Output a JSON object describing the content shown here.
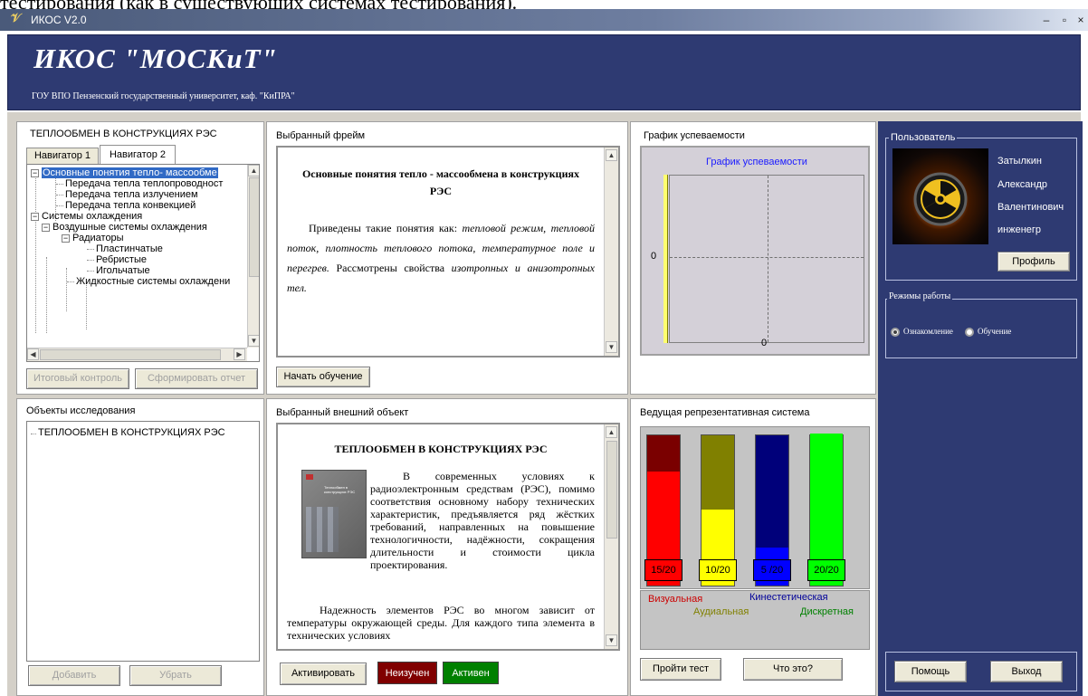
{
  "doc_caption": "тестирования (как в существующих системах тестирования).",
  "window": {
    "title": "ИКОС V2.0",
    "min": "–",
    "max": "▫",
    "close": "×"
  },
  "banner": {
    "title": "ИКОС  \"МОСКиТ\"",
    "subtitle": "ГОУ ВПО Пензенский государственный университет, каф. \"КиПРА\""
  },
  "navigator": {
    "title": "ТЕПЛООБМЕН В КОНСТРУКЦИЯХ РЭС",
    "tabs": [
      "Навигатор 1",
      "Навигатор 2"
    ],
    "active_tab": "Навигатор 2",
    "tree": [
      {
        "label": "Основные понятия тепло- массообме",
        "expander": "−",
        "selected": true
      },
      {
        "label": "Передача тепла теплопроводност"
      },
      {
        "label": "Передача тепла излучением"
      },
      {
        "label": "Передача тепла конвекцией"
      },
      {
        "label": "Системы охлаждения",
        "expander": "−"
      },
      {
        "label": "Воздушные системы охлаждения",
        "expander": "−"
      },
      {
        "label": "Радиаторы",
        "expander": "−"
      },
      {
        "label": "Пластинчатые"
      },
      {
        "label": "Ребристые"
      },
      {
        "label": "Игольчатые"
      },
      {
        "label": "Жидкостные системы охлаждени"
      }
    ],
    "btn_final": "Итоговый контроль",
    "btn_report": "Сформировать отчет"
  },
  "frame": {
    "title": "Выбранный фрейм",
    "heading": "Основные понятия тепло - массообмена в конструкциях РЭС",
    "text_a": "Приведены такие понятия как: ",
    "text_b": "тепловой режим, тепловой поток, плотность теплового потока, температурное поле и перегрев.",
    "text_c": " Рассмотрены свойства ",
    "text_d": "изотропных и анизотропных тел.",
    "btn_start": "Начать обучение"
  },
  "progress_chart": {
    "title": "График успеваемости",
    "inner_title": "График успеваемости",
    "y_tick": "0",
    "x_tick": "0"
  },
  "user": {
    "group_label": "Пользователь",
    "last_name": "Затылкин",
    "first_name": "Александр",
    "patronymic": "Валентинович",
    "position": "инженегр",
    "btn_profile": "Профиль",
    "avatar_icon": "radiation-icon"
  },
  "modes": {
    "group_label": "Режимы работы",
    "options": [
      "Ознакомление",
      "Обучение"
    ],
    "selected": "Ознакомление"
  },
  "objects": {
    "title": "Объекты исследования",
    "items": [
      "ТЕПЛООБМЕН В КОНСТРУКЦИЯХ РЭС"
    ],
    "btn_add": "Добавить",
    "btn_remove": "Убрать"
  },
  "external": {
    "title": "Выбранный внешний объект",
    "heading": "ТЕПЛООБМЕН В КОНСТРУКЦИЯХ РЭС",
    "para1": "В современных условиях к радиоэлектронным средствам (РЭС), помимо соответствия основному набору технических характеристик, предъявляется ряд жёстких требований, направленных на повышение технологичности, надёжности, сокращения длительности и стоимости цикла проектирования.",
    "para2": "Надежность элементов РЭС во многом зависит от температуры окружающей среды. Для каждого типа элемента в технических условиях",
    "book_title": "Теплообмен в конструкциях РЭС",
    "btn_activate": "Активировать",
    "status_unstudied": "Неизучен",
    "status_active": "Активен"
  },
  "rep_system": {
    "title": "Ведущая репрезентативная система",
    "legend": [
      "Визуальная",
      "Кинестетическая",
      "Аудиальная",
      "Дискретная"
    ],
    "btn_test": "Пройти тест",
    "btn_what": "Что это?"
  },
  "footer": {
    "btn_help": "Помощь",
    "btn_exit": "Выход"
  },
  "colors": {
    "banner": "#2e3a72",
    "visual": "#ff0000",
    "auditory": "#ffff00",
    "kinesthetic": "#0000ff",
    "discrete": "#00ff00"
  },
  "chart_data": {
    "type": "bar",
    "categories": [
      "Визуальная",
      "Аудиальная",
      "Кинестетическая",
      "Дискретная"
    ],
    "values": [
      15,
      10,
      5,
      20
    ],
    "labels": [
      "15/20",
      "10/20",
      "5 /20",
      "20/20"
    ],
    "max": 20,
    "colors": [
      "#ff0000",
      "#ffff00",
      "#0000ff",
      "#00ff00"
    ],
    "dark_colors": [
      "#7a0000",
      "#808000",
      "#00007a",
      "#007a00"
    ]
  }
}
